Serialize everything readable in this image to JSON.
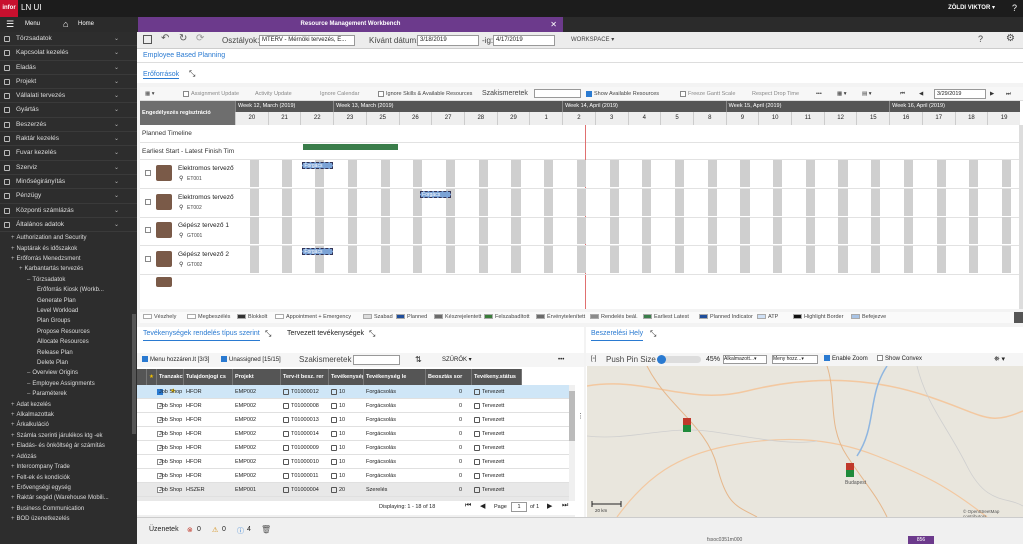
{
  "topbar": {
    "logo": "infor",
    "app_title": "LN UI",
    "user": "ZÖLDI VIKTOR"
  },
  "nav": {
    "menu": "Menu",
    "home": "Home",
    "doc_tab": "Resource Management Workbench"
  },
  "sidebar": {
    "items": [
      "Törzsadatok",
      "Kapcsolat kezelés",
      "Eladás",
      "Projekt",
      "Vállalati tervezés",
      "Gyártás",
      "Beszerzés",
      "Raktár kezelés",
      "Fuvar kezelés",
      "Szerviz",
      "Minőségirányítás",
      "Pénzügy",
      "Központi számlázás",
      "Általános adatok"
    ],
    "tree": [
      {
        "t": "Authorization and Security",
        "d": 1
      },
      {
        "t": "Naptárak és időszakok",
        "d": 1
      },
      {
        "t": "Erőforrás Menedzsment",
        "d": 1
      },
      {
        "t": "Karbantartás tervezés",
        "d": 2
      },
      {
        "t": "Törzsadatok",
        "d": 3
      },
      {
        "t": "Erőforrás Kiosk (Workb...",
        "d": 4
      },
      {
        "t": "Generate Plan",
        "d": 4
      },
      {
        "t": "Level Workload",
        "d": 4
      },
      {
        "t": "Plan Groups",
        "d": 4
      },
      {
        "t": "Propose Resources",
        "d": 4
      },
      {
        "t": "Allocate Resources",
        "d": 4
      },
      {
        "t": "Release Plan",
        "d": 4
      },
      {
        "t": "Delete Plan",
        "d": 4
      },
      {
        "t": "Overview Origins",
        "d": 3
      },
      {
        "t": "Employee Assignments",
        "d": 3
      },
      {
        "t": "Paraméterek",
        "d": 3
      },
      {
        "t": "Adat kezelés",
        "d": 1
      },
      {
        "t": "Alkalmazottak",
        "d": 1
      },
      {
        "t": "Árkalkuláció",
        "d": 1
      },
      {
        "t": "Számla szerinti járulékos ktg -ek",
        "d": 1
      },
      {
        "t": "Eladás- és önköltség ár számítás",
        "d": 1
      },
      {
        "t": "Adózás",
        "d": 1
      },
      {
        "t": "Intercompany Trade",
        "d": 1
      },
      {
        "t": "Felt-ek és kondíciók",
        "d": 1
      },
      {
        "t": "Erővengségi egység",
        "d": 1
      },
      {
        "t": "Raktár segéd (Warehouse Mobili...",
        "d": 1
      },
      {
        "t": "Business Communication",
        "d": 1
      },
      {
        "t": "BOD üzenetkezelés",
        "d": 1
      }
    ]
  },
  "toolbar": {
    "osztalyok_label": "Osztályok:",
    "osztalyok_value": "MTERV - Mérnöki tervezés, E...",
    "kivant_label": "Kívánt dátum:",
    "date_from": "3/18/2019",
    "ig_label": "-ig:",
    "date_to": "4/17/2019",
    "workspace": "WORKSPACE"
  },
  "panel_tabs": {
    "main": "Employee Based Planning",
    "sub": "Erőforrások"
  },
  "gantt_toolbar": {
    "assignment_update": "Assignment Update",
    "activity_update": "Activity Update",
    "ignore_calendar": "Ignore Calendar",
    "ignore_skills": "Ignore Skills & Available Resources",
    "szakismeretek": "Szakismeretek",
    "show_available": "Show Available Resources",
    "freeze_gantt": "Freeze Gantt Scale",
    "respect_drop": "Respect Drop Time",
    "nav_date": "3/29/2019"
  },
  "gantt": {
    "header_left": "Engedélyezés regisztráció",
    "weeks": [
      "Week 12, March (2019)",
      "Week 13, March (2019)",
      "Week 14, April (2019)",
      "Week 15, April (2019)",
      "Week 16, April (2019)"
    ],
    "days": [
      "20",
      "21",
      "22",
      "23",
      "25",
      "26",
      "27",
      "28",
      "29",
      "1",
      "2",
      "3",
      "4",
      "5",
      "8",
      "9",
      "10",
      "11",
      "12",
      "15",
      "16",
      "17",
      "18",
      "19"
    ],
    "planned_timeline": "Planned Timeline",
    "earliest": "Earliest Start - Latest Finish Tim",
    "chip_label": "Forgács",
    "resources": [
      {
        "name": "Elektromos tervező",
        "code": "ET001"
      },
      {
        "name": "Elektromos tervező",
        "code": "ET002"
      },
      {
        "name": "Gépész tervező 1",
        "code": "GT001"
      },
      {
        "name": "Gépész tervező 2",
        "code": "GT002"
      }
    ]
  },
  "legend": [
    {
      "label": "Vészhely",
      "color": "#ffffff"
    },
    {
      "label": "Megbeszélés",
      "color": "#ffffff"
    },
    {
      "label": "Blokkolt",
      "color": "#333333"
    },
    {
      "label": "Appointment + Emergency",
      "color": "#ffffff"
    },
    {
      "label": "Szabad",
      "color": "#dddddd"
    },
    {
      "label": "Planned",
      "color": "#1f4e9b"
    },
    {
      "label": "Készrejelentett",
      "color": "#6b6b6b"
    },
    {
      "label": "Felszabadított",
      "color": "#3a7d3a"
    },
    {
      "label": "Érvénytelenített",
      "color": "#6b6b6b"
    },
    {
      "label": "Rendelés beál.",
      "color": "#8a8a8a"
    },
    {
      "label": "Earliest Latest",
      "color": "#3a7d4a"
    },
    {
      "label": "Planned Indicator",
      "color": "#1f4e9b"
    },
    {
      "label": "ATP",
      "color": "#cfe0f5"
    },
    {
      "label": "Highlight Border",
      "color": "#111111"
    },
    {
      "label": "Befejezve",
      "color": "#a9c4e6"
    }
  ],
  "lpanel": {
    "tab1": "Tevékenységek rendelés típus szerint",
    "tab2": "Tervezett tevékenységek",
    "menu_label": "Menu hozzáren.lt [3/3]",
    "unassigned_label": "Unassigned [15/15]",
    "szakismeretek": "Szakismeretek",
    "szurok": "SZŰRŐK",
    "columns": [
      "Tranzakció erec",
      "Tulajdonjogi cs",
      "Projekt",
      "Terv-it besz. rer",
      "Tevékenységi s",
      "Tevékenység le",
      "Beosztás sor",
      "Tevékeny.státus"
    ],
    "rows": [
      [
        "Job Shop",
        "HFOR",
        "EMP002",
        "T01000012",
        "10",
        "Forgácsolás",
        "0",
        "Tervezett"
      ],
      [
        "Job Shop",
        "HFOR",
        "EMP002",
        "T01000008",
        "10",
        "Forgácsolás",
        "0",
        "Tervezett"
      ],
      [
        "Job Shop",
        "HFOR",
        "EMP002",
        "T01000013",
        "10",
        "Forgácsolás",
        "0",
        "Tervezett"
      ],
      [
        "Job Shop",
        "HFOR",
        "EMP002",
        "T01000014",
        "10",
        "Forgácsolás",
        "0",
        "Tervezett"
      ],
      [
        "Job Shop",
        "HFOR",
        "EMP002",
        "T01000009",
        "10",
        "Forgácsolás",
        "0",
        "Tervezett"
      ],
      [
        "Job Shop",
        "HFOR",
        "EMP002",
        "T01000010",
        "10",
        "Forgácsolás",
        "0",
        "Tervezett"
      ],
      [
        "Job Shop",
        "HFOR",
        "EMP002",
        "T01000011",
        "10",
        "Forgácsolás",
        "0",
        "Tervezett"
      ],
      [
        "Job Shop",
        "HSZER",
        "EMP001",
        "T01000004",
        "20",
        "Szerelés",
        "0",
        "Tervezett"
      ],
      [
        "Job Shop",
        "HSZER",
        "EMP002",
        "T01000008",
        "20",
        "Szerelés",
        "0",
        "Tervezett"
      ]
    ],
    "displaying": "Displaying: 1 - 18 of 18",
    "page_label": "Page",
    "page": "1",
    "of": "of 1"
  },
  "rpanel": {
    "tab": "Beszerelési Hely",
    "push_pin": "Push Pin Size",
    "zoom_pct": "45%",
    "alk": "Alkalmazott...",
    "meny": "Meny hozz...",
    "enable_zoom": "Enable Zoom",
    "show_convex": "Show Convex",
    "map_credit": "© OpenStreetMap contributors",
    "city": "Budapest",
    "scale": "20 km"
  },
  "status": {
    "label": "Üzenetek",
    "c1": "0",
    "c2": "0",
    "c3": "4",
    "session": "fssoc0351m000",
    "num": "856"
  }
}
